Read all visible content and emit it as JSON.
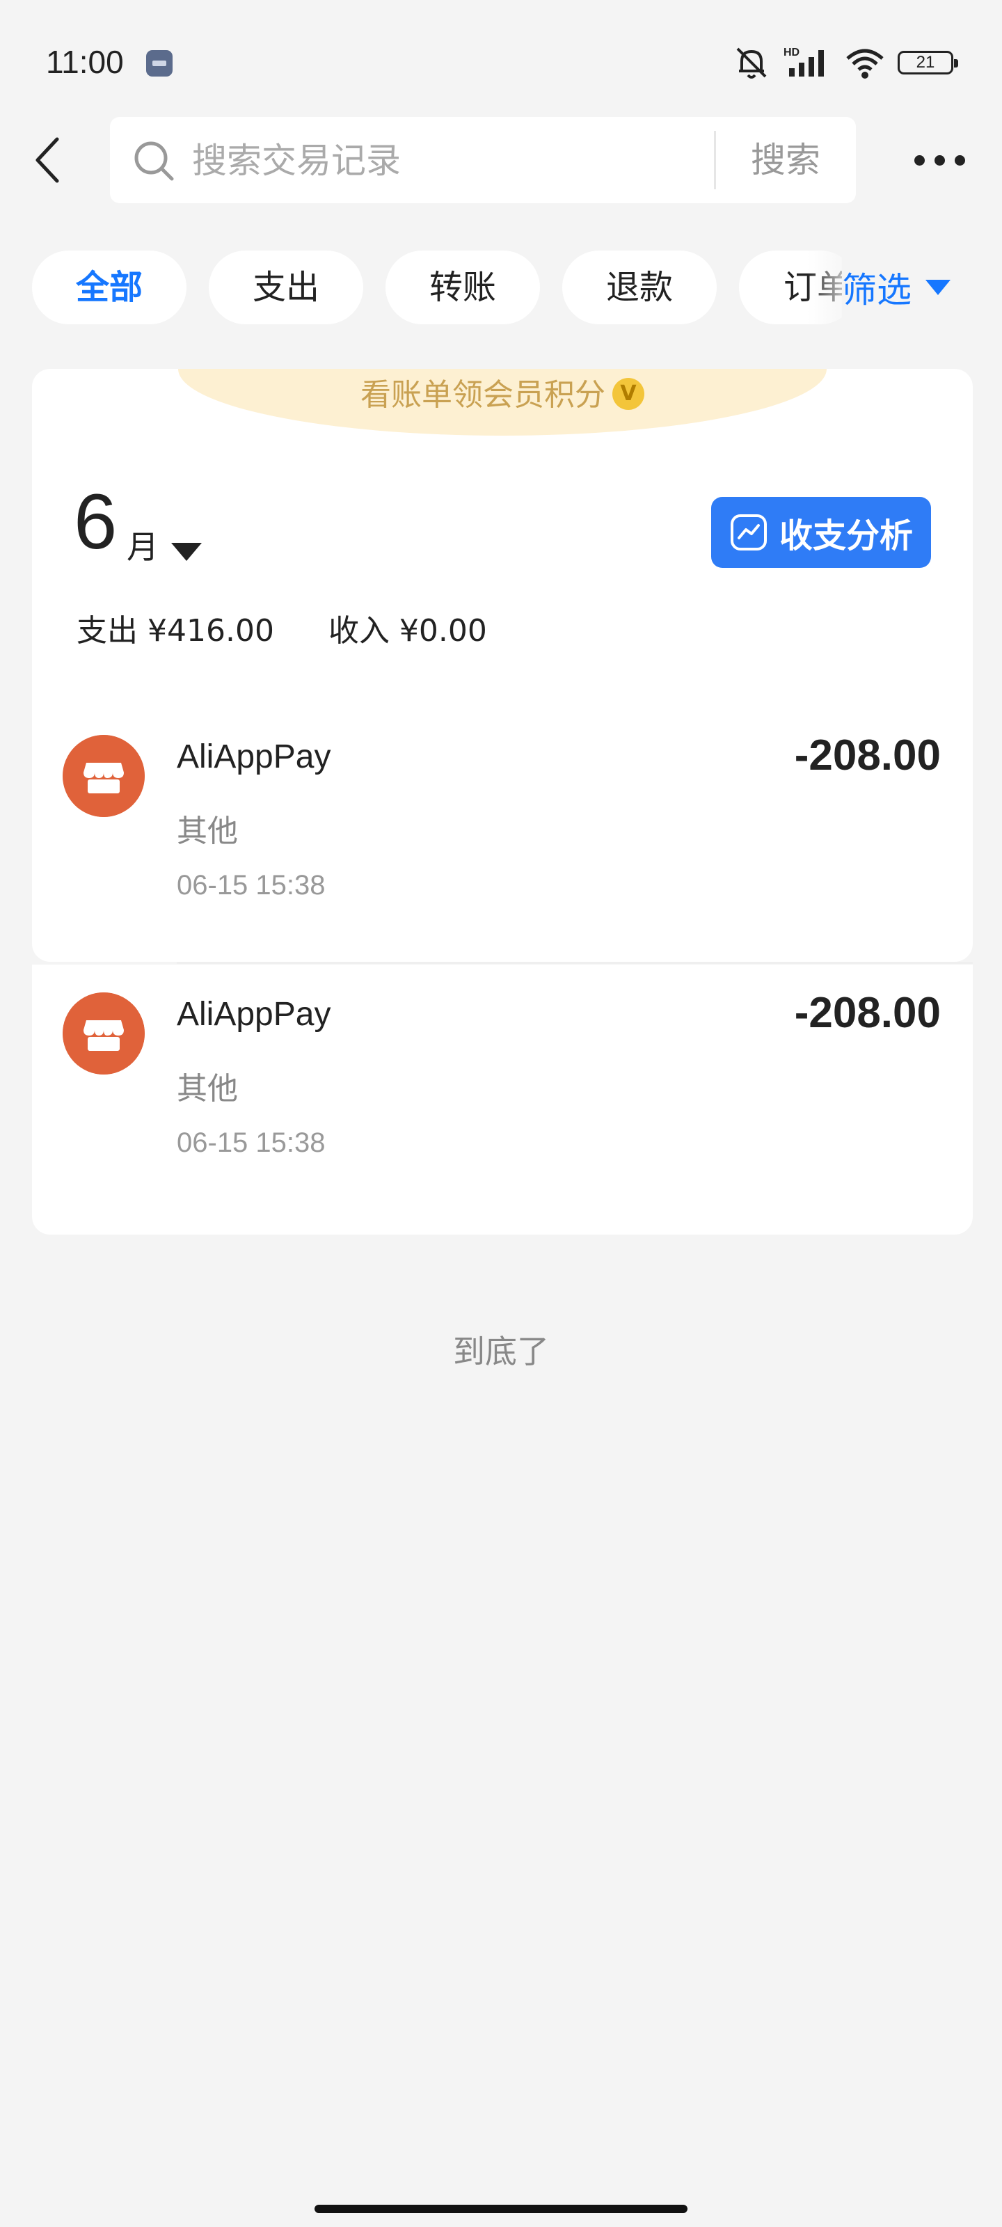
{
  "status_bar": {
    "time": "11:00",
    "battery": "21"
  },
  "search": {
    "placeholder": "搜索交易记录",
    "button_label": "搜索"
  },
  "tabs": [
    {
      "label": "全部",
      "active": true
    },
    {
      "label": "支出",
      "active": false
    },
    {
      "label": "转账",
      "active": false
    },
    {
      "label": "退款",
      "active": false
    },
    {
      "label": "订单",
      "active": false
    }
  ],
  "filter": {
    "label": "筛选"
  },
  "banner": {
    "text": "看账单领会员积分",
    "badge": "V"
  },
  "month": {
    "number": "6",
    "unit": "月"
  },
  "analysis_button": {
    "label": "收支分析"
  },
  "summary": {
    "expense": "支出 ¥416.00",
    "income": "收入 ¥0.00"
  },
  "transactions": [
    {
      "merchant": "AliAppPay",
      "category": "其他",
      "time": "06-15 15:38",
      "amount": "-208.00"
    },
    {
      "merchant": "AliAppPay",
      "category": "其他",
      "time": "06-15 15:38",
      "amount": "-208.00"
    }
  ],
  "end_text": "到底了",
  "colors": {
    "accent": "#1677ff",
    "button_blue": "#2f7cf6",
    "merchant_icon": "#e0623a",
    "banner_bg": "#fdf0d2",
    "banner_text": "#c9a152",
    "page_bg": "#f4f4f4"
  }
}
